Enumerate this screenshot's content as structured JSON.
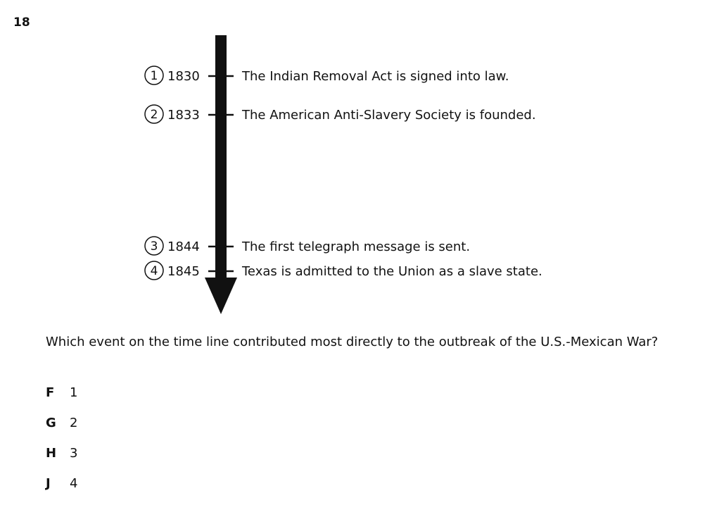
{
  "question_number": "18",
  "timeline": {
    "events": [
      {
        "marker": "1",
        "year": "1830",
        "text": "The Indian Removal Act is signed into law."
      },
      {
        "marker": "2",
        "year": "1833",
        "text": "The American Anti-Slavery Society is founded."
      },
      {
        "marker": "3",
        "year": "1844",
        "text": "The first telegraph message is sent."
      },
      {
        "marker": "4",
        "year": "1845",
        "text": "Texas is admitted to the Union as a slave state."
      }
    ]
  },
  "question_text": "Which event on the time line contributed most directly to the outbreak of the U.S.-Mexican War?",
  "choices": [
    {
      "letter": "F",
      "value": "1"
    },
    {
      "letter": "G",
      "value": "2"
    },
    {
      "letter": "H",
      "value": "3"
    },
    {
      "letter": "J",
      "value": "4"
    }
  ]
}
